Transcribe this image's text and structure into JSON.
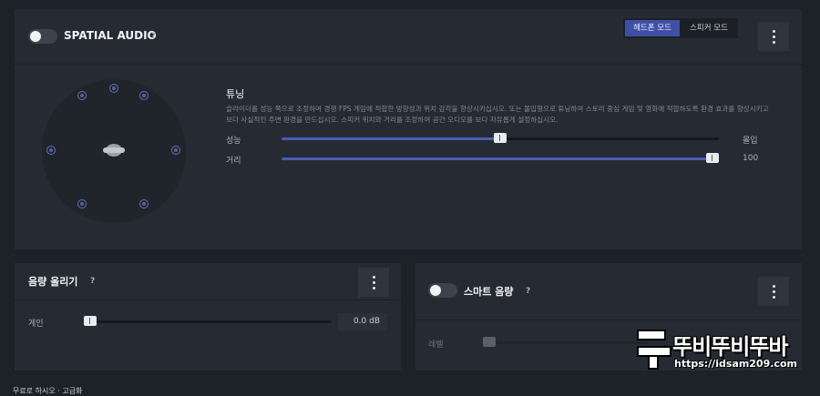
{
  "spatial_audio": {
    "title": "SPATIAL AUDIO",
    "help": "?",
    "enabled": false,
    "modes": [
      "헤드폰 모드",
      "스피커 모드"
    ],
    "active_mode": "헤드폰 모드",
    "tuning": {
      "title": "튜닝",
      "description": "슬라이더를 성능 쪽으로 조정하여 경쟁 FPS 게임에 적합한 방향성과 위치 감각을 향상시키십시오. 또는 몰입형으로 튜닝하여 스토리 중심 게임 및 영화에 적합하도록 환경 효과를 향상시키고 보다 사실적인 주변 환경을 만드십시오. 스피커 위치와 거리를 조정하여 공간 오디오를 보다 자유롭게 설정하십시오.",
      "sliders": [
        {
          "label": "성능",
          "end_label": "몰입",
          "fraction": 0.5
        },
        {
          "label": "거리",
          "end_label": "100",
          "fraction": 1.0
        }
      ]
    }
  },
  "volume_boost": {
    "title": "음량 올리기",
    "help": "?",
    "gain_label": "게인",
    "gain_value": "0.0 dB",
    "gain_fraction": 0.0
  },
  "smart_volume": {
    "title": "스마트 음량",
    "help": "?",
    "enabled": false,
    "level_label": "레벨"
  },
  "footer": {
    "partial_text": "무료로 하시오 · 고급화"
  },
  "watermark": {
    "text": "뚜비뚜비뚜바",
    "url": "https://idsam209.com"
  },
  "colors": {
    "accent": "#3f4fa6",
    "slider_fill": "#4b5bb4",
    "panel": "#262b33",
    "background": "#1d2228"
  }
}
